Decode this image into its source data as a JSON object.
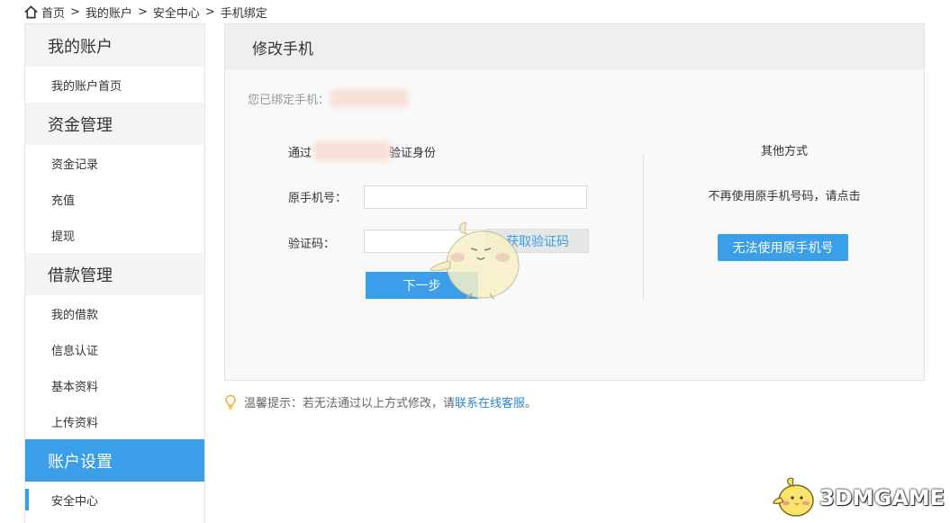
{
  "breadcrumb": {
    "items": [
      "首页",
      "我的账户",
      "安全中心",
      "手机绑定"
    ],
    "separator": ">"
  },
  "sidebar": {
    "sections": [
      {
        "title": "我的账户",
        "items": [
          "我的账户首页"
        ]
      },
      {
        "title": "资金管理",
        "items": [
          "资金记录",
          "充值",
          "提现"
        ]
      },
      {
        "title": "借款管理",
        "items": [
          "我的借款",
          "信息认证",
          "基本资料",
          "上传资料"
        ]
      },
      {
        "title": "账户设置",
        "items": [
          "安全中心"
        ]
      }
    ],
    "active_section": "账户设置",
    "selected_item": "安全中心"
  },
  "panel": {
    "title": "修改手机",
    "bound_label": "您已绑定手机：",
    "verify_prefix": "通过",
    "verify_suffix": "验证身份",
    "old_phone_label": "原手机号：",
    "code_label": "验证码：",
    "get_code_button": "获取验证码",
    "next_button": "下一步",
    "other_title": "其他方式",
    "other_note": "不再使用原手机号码，请点击",
    "alt_button": "无法使用原手机号"
  },
  "tip": {
    "prefix": "温馨提示：若无法通过以上方式修改，请",
    "link": "联系在线客服",
    "suffix": "。"
  },
  "watermark": {
    "text": "3DMGAME"
  },
  "colors": {
    "accent": "#3a9ee8",
    "link": "#2c86cf",
    "sidebar_section_bg": "#f4f4f4",
    "panel_bg": "#f9f9f9"
  }
}
